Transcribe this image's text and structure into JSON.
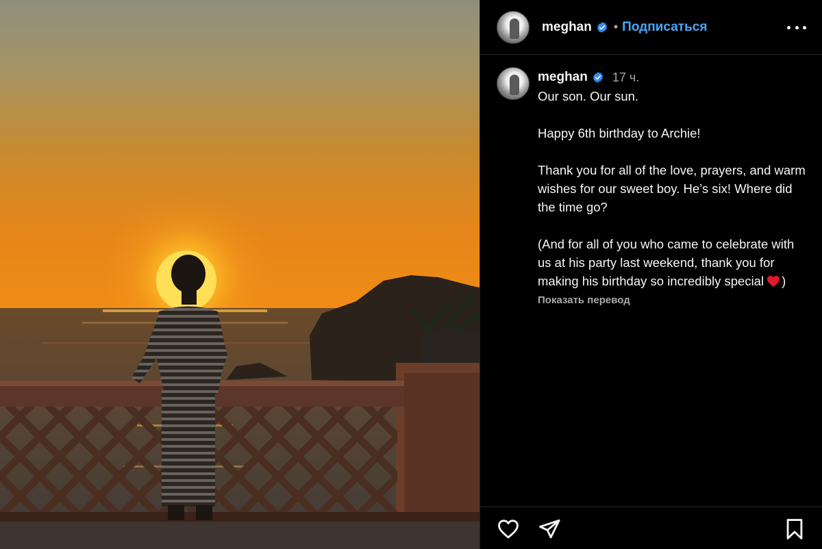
{
  "post": {
    "author": "meghan",
    "follow_label": "Подписаться",
    "separator": "•",
    "timestamp": "17 ч.",
    "caption": "Our son. Our sun.\n\nHappy 6th birthday to Archie!\n\nThank you for all of the love, prayers, and warm wishes for our sweet boy. He’s six! Where did the time go?\n\n(And for all of you who came to celebrate with us at his party last weekend, thank you for making his birthday so incredibly special",
    "caption_end": ")",
    "translate_label": "Показать перевод"
  },
  "icons": {
    "verified": "verified-badge-icon",
    "more": "more-options-icon",
    "heart_emoji": "red-heart-emoji",
    "like": "heart-outline-icon",
    "share": "paper-plane-icon",
    "save": "bookmark-icon"
  },
  "colors": {
    "background": "#000000",
    "link": "#4aa6f5",
    "verified": "#2f8cf0",
    "muted": "#a8a8a8",
    "heart": "#e0182c"
  }
}
